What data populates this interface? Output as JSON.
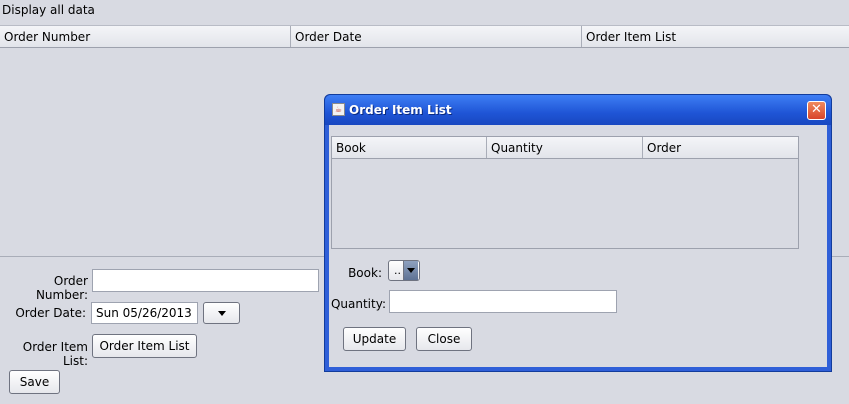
{
  "main": {
    "caption": "Display all data",
    "columns": [
      "Order Number",
      "Order Date",
      "Order Item List"
    ]
  },
  "form": {
    "order_number_label": "Order Number:",
    "order_number_value": "",
    "order_date_label": "Order Date:",
    "order_date_value": "Sun 05/26/2013",
    "order_item_list_label": "Order Item List:",
    "order_item_list_button": "Order Item List",
    "save_button": "Save"
  },
  "dialog": {
    "title": "Order Item List",
    "app_icon": "java-icon",
    "close_icon": "close-icon",
    "columns": [
      "Book",
      "Quantity",
      "Order"
    ],
    "book_label": "Book:",
    "book_value": "..",
    "quantity_label": "Quantity:",
    "quantity_value": "",
    "update_button": "Update",
    "close_button": "Close"
  }
}
